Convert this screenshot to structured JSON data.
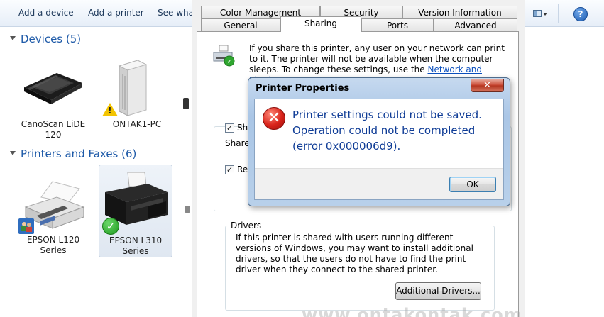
{
  "toolbar": {
    "add_device": "Add a device",
    "add_printer": "Add a printer",
    "see_what": "See what"
  },
  "groups": {
    "devices": "Devices (5)",
    "printers": "Printers and Faxes (6)"
  },
  "devices": [
    {
      "label": "CanoScan LiDE 120"
    },
    {
      "label": "ONTAK1-PC"
    }
  ],
  "printers": [
    {
      "label": "EPSON L120 Series"
    },
    {
      "label": "EPSON L310 Series",
      "status": "default"
    }
  ],
  "properties": {
    "tabs_top": [
      "Color Management",
      "Security",
      "Version Information"
    ],
    "tabs_bottom": [
      "General",
      "Sharing",
      "Ports",
      "Advanced"
    ],
    "active_tab": "Sharing",
    "share_text": "If you share this printer, any user on your network can print to it. The printer will not be available when the computer sleeps. To change these settings, use the",
    "share_link": "Network and Sharing Center.",
    "share_check_stub": "Shar",
    "share_name_stub": "Share n",
    "render_check_stub": "Ren",
    "drivers_legend": "Drivers",
    "drivers_text": "If this printer is shared with users running different versions of Windows, you may want to install additional drivers, so that the users do not have to find the print driver when they connect to the shared printer.",
    "additional_drivers_button": "Additional Drivers..."
  },
  "error_dialog": {
    "title": "Printer Properties",
    "close_symbol": "✕",
    "message": "Printer settings could not be saved. Operation could not be completed (error 0x000006d9).",
    "ok_button": "OK"
  },
  "watermark": "www.ontakontak.com",
  "colors": {
    "link": "#0b4fbd",
    "error_text": "#0f3c96",
    "group_header": "#1e5aa8"
  }
}
